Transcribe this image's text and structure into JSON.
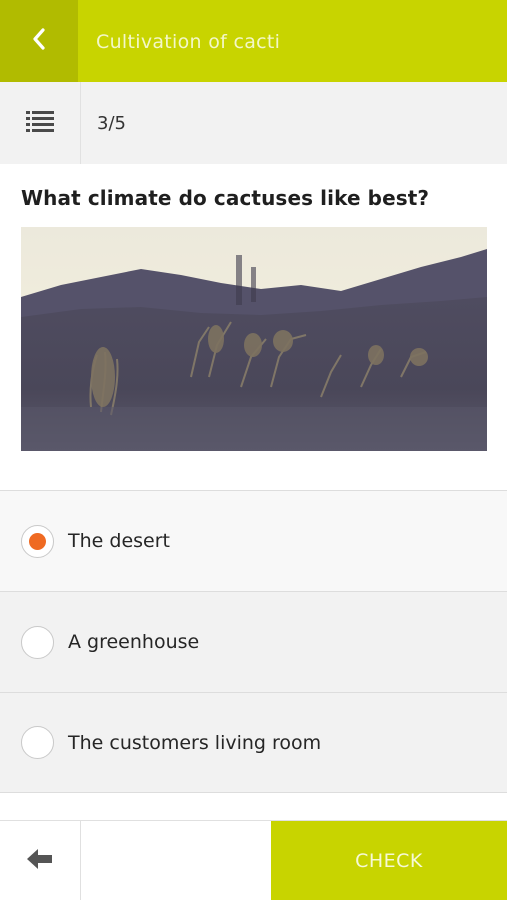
{
  "header": {
    "title": "Cultivation of cacti",
    "back_icon": "chevron-left-icon"
  },
  "subbar": {
    "list_icon": "list-icon",
    "progress": "3/5"
  },
  "question": {
    "text": "What climate do cactuses like best?"
  },
  "answers": [
    {
      "label": "The desert",
      "selected": true
    },
    {
      "label": "A greenhouse",
      "selected": false
    },
    {
      "label": "The customers living room",
      "selected": false
    }
  ],
  "footer": {
    "prev_icon": "arrow-left-icon",
    "check_label": "CHECK"
  },
  "colors": {
    "accent": "#c8d400",
    "accent_dark": "#b1bb00",
    "radio_selected": "#ef6a22"
  }
}
